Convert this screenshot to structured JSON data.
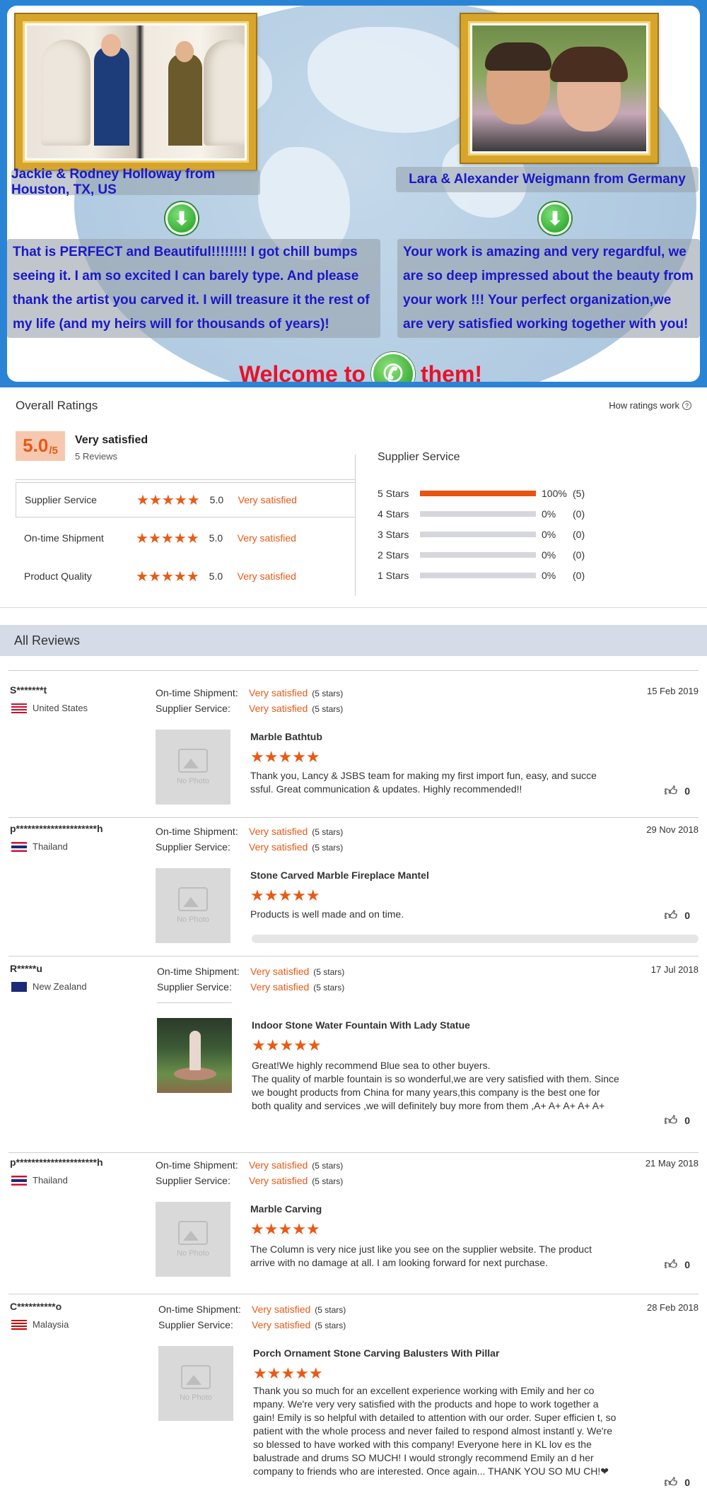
{
  "banner": {
    "left_caption": "Jackie & Rodney Holloway from Houston, TX, US",
    "right_caption": "Lara & Alexander Weigmann from Germany",
    "left_quote": "That is PERFECT and Beautiful!!!!!!!! I got chill bumps seeing it. I am so excited I can barely type. And please thank the artist you carved it. I will treasure it the rest of my life (and my heirs will for thousands of years)!",
    "right_quote": "Your work is amazing and very regardful, we are so deep impressed about the beauty from your work !!! Your perfect organization,we are very satisfied working together with you!",
    "welcome_before": "Welcome to",
    "welcome_after": "them!",
    "accent_color": "#e8122b",
    "caption_color": "#1a18c9",
    "icons": [
      "down-arrow-icon",
      "phone-icon"
    ]
  },
  "ratings": {
    "title": "Overall Ratings",
    "how_link": "How ratings work",
    "score": "5.0",
    "score_suffix": "/5",
    "summary": "Very satisfied",
    "review_count": "5 Reviews",
    "rows": [
      {
        "label": "Supplier Service",
        "stars": "★★★★★",
        "value": "5.0",
        "text": "Very satisfied"
      },
      {
        "label": "On-time Shipment",
        "stars": "★★★★★",
        "value": "5.0",
        "text": "Very satisfied"
      },
      {
        "label": "Product Quality",
        "stars": "★★★★★",
        "value": "5.0",
        "text": "Very satisfied"
      }
    ],
    "distribution_title": "Supplier Service",
    "distribution": [
      {
        "label": "5 Stars",
        "fraction": 1.0,
        "pct": "100%",
        "count": "(5)"
      },
      {
        "label": "4 Stars",
        "fraction": 0,
        "pct": "0%",
        "count": "(0)"
      },
      {
        "label": "3 Stars",
        "fraction": 0,
        "pct": "0%",
        "count": "(0)"
      },
      {
        "label": "2 Stars",
        "fraction": 0,
        "pct": "0%",
        "count": "(0)"
      },
      {
        "label": "1 Stars",
        "fraction": 0,
        "pct": "0%",
        "count": "(0)"
      }
    ],
    "star_color": "#e85a16"
  },
  "reviews": {
    "title": "All Reviews",
    "shipment_label": "On-time Shipment:",
    "service_label": "Supplier Service:",
    "no_photo": "No Photo",
    "items": [
      {
        "user": "S*******t",
        "country": "United States",
        "flag": "us",
        "shipment": "Very satisfied",
        "shipment_stars": "(5 stars)",
        "service": "Very satisfied",
        "service_stars": "(5 stars)",
        "date": "15 Feb 2019",
        "product": "Marble Bathtub",
        "stars": "★★★★★",
        "text": "Thank you, Lancy & JSBS team for making my first import fun, easy, and succe ssful. Great communication & updates. Highly recommended!!",
        "likes": "0",
        "photo": "none"
      },
      {
        "user": "p*********************h",
        "country": "Thailand",
        "flag": "th",
        "shipment": "Very satisfied",
        "shipment_stars": "(5 stars)",
        "service": "Very satisfied",
        "service_stars": "(5 stars)",
        "date": "29 Nov 2018",
        "product": "Stone Carved Marble Fireplace Mantel",
        "stars": "★★★★★",
        "text": "Products is well made and on time.",
        "likes": "0",
        "photo": "none"
      },
      {
        "user": "R*****u",
        "country": "New Zealand",
        "flag": "nz",
        "shipment": "Very satisfied",
        "shipment_stars": "(5 stars)",
        "service": "Very satisfied",
        "service_stars": "(5 stars)",
        "date": "17 Jul 2018",
        "product": "Indoor Stone Water Fountain With Lady Statue",
        "stars": "★★★★★",
        "text": "Great!We highly recommend Blue sea to other buyers.\nThe quality of marble fountain is so wonderful,we are very satisfied with them. Since we bought products from China for many years,this company is the best one for both quality and services ,we will definitely buy more from them ,A+ A+ A+ A+ A+",
        "likes": "0",
        "photo": "fountain"
      },
      {
        "user": "p*********************h",
        "country": "Thailand",
        "flag": "th",
        "shipment": "Very satisfied",
        "shipment_stars": "(5 stars)",
        "service": "Very satisfied",
        "service_stars": "(5 stars)",
        "date": "21 May 2018",
        "product": "Marble Carving",
        "stars": "★★★★★",
        "text": "The Column is very nice just like you see on the supplier website. The product arrive with no damage at all. I am looking forward for next purchase.",
        "likes": "0",
        "photo": "none"
      },
      {
        "user": "C**********o",
        "country": "Malaysia",
        "flag": "my",
        "shipment": "Very satisfied",
        "shipment_stars": "(5 stars)",
        "service": "Very satisfied",
        "service_stars": "(5 stars)",
        "date": "28 Feb 2018",
        "product": "Porch Ornament Stone Carving Balusters With Pillar",
        "stars": "★★★★★",
        "text": "Thank you so much for an excellent experience working with Emily and her co mpany. We're very very satisfied with the products and hope to work together a gain! Emily is so helpful with detailed to attention with our order. Super efficien t, so patient with the whole process and never failed to respond almost instantl y. We're so blessed to have worked with this company! Everyone here in KL lov es the balustrade and drums SO MUCH! I would strongly recommend Emily an d her company to friends who are interested. Once again... THANK YOU SO MU CH!❤",
        "likes": "0",
        "photo": "none"
      }
    ]
  }
}
